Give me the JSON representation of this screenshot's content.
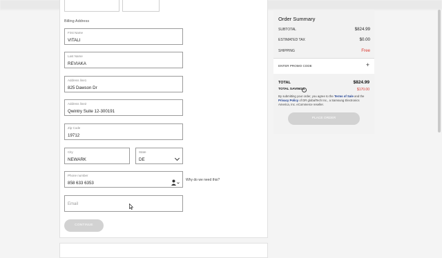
{
  "billing": {
    "section_label": "Billing Address",
    "first_name": {
      "label": "First Name",
      "value": "VITALI"
    },
    "last_name": {
      "label": "Last Name",
      "value": "REVIAKA"
    },
    "address1": {
      "label": "Address line1",
      "value": "825 Dawson Dr"
    },
    "address2": {
      "label": "Address line2",
      "value": "Qwintry Suite 12-300191"
    },
    "zip": {
      "label": "Zip Code",
      "value": "19712"
    },
    "city": {
      "label": "City",
      "value": "NEWARK"
    },
    "state": {
      "label": "State",
      "value": "DE"
    },
    "phone": {
      "label": "Phone number",
      "value": "858 633 6353"
    },
    "email": {
      "placeholder": "Email"
    },
    "why_link": "Why do we need this?",
    "continue_label": "CONTINUE"
  },
  "summary": {
    "title": "Order Summary",
    "subtotal_label": "SUBTOTAL",
    "subtotal_value": "$824.99",
    "tax_label": "ESTIMATED TAX",
    "tax_value": "$0.00",
    "shipping_label": "SHIPPING",
    "shipping_value": "Free",
    "promo_label": "ENTER PROMO CODE",
    "total_label": "TOTAL",
    "total_value": "$824.99",
    "savings_label": "TOTAL SAVINGS",
    "savings_value": "$170.00",
    "legal": {
      "p1": "By submitting your order, you agree to the ",
      "terms": "Terms of Sale",
      "p2": " and the ",
      "privacy": "Privacy Policy",
      "p3": " of DR globalTech Inc., a Samsung Electronics America, Inc. eCommerce reseller."
    },
    "place_order_label": "PLACE ORDER"
  },
  "colors": {
    "accent_red": "#d9342b",
    "link_blue": "#1c3d8f",
    "disabled_button": "#d2d2d2"
  }
}
